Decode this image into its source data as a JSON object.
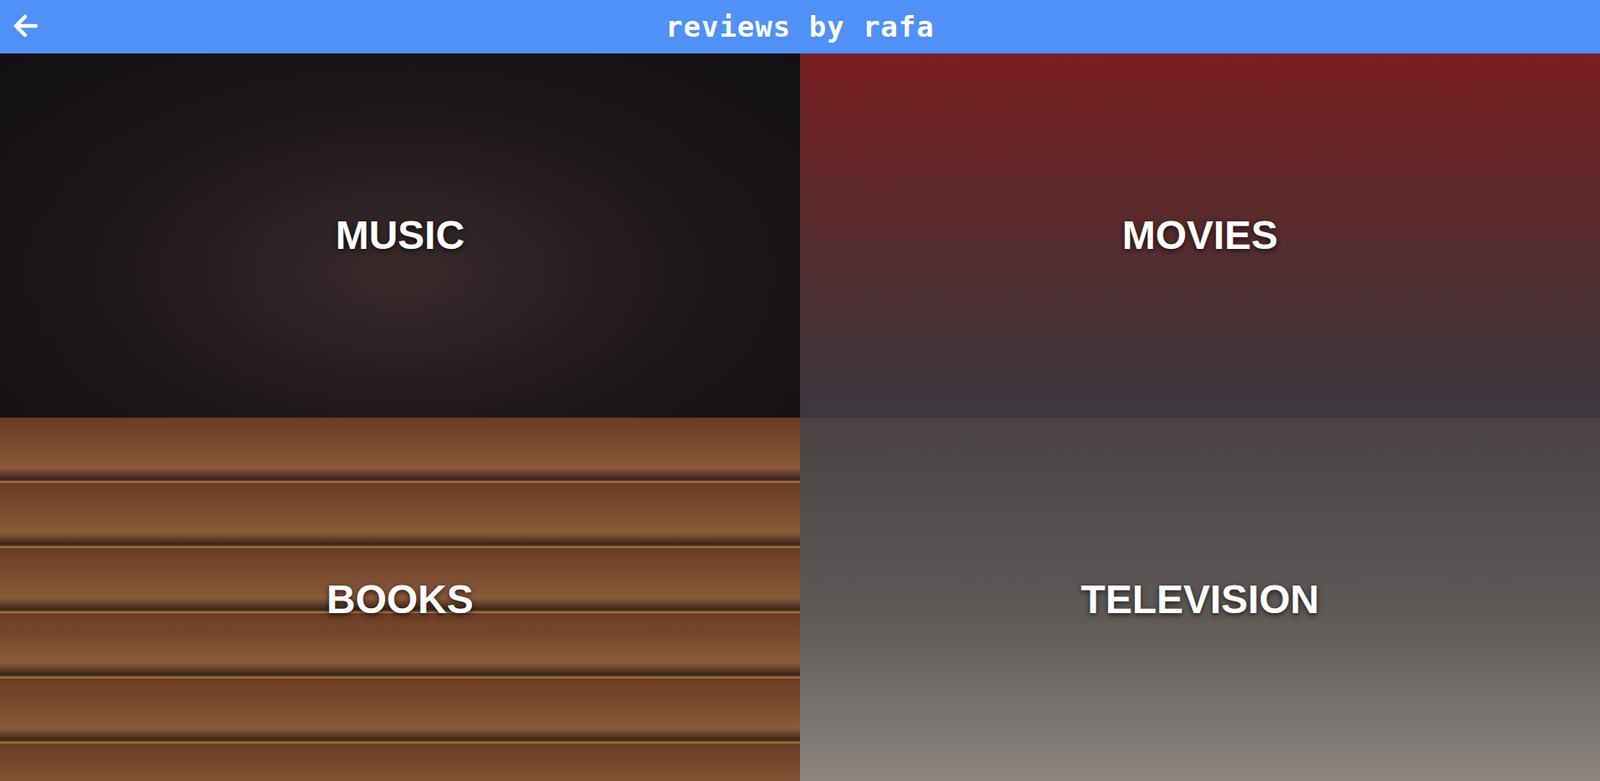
{
  "header": {
    "title": "reviews by rafa"
  },
  "categories": [
    {
      "label": "MUSIC"
    },
    {
      "label": "MOVIES"
    },
    {
      "label": "BOOKS"
    },
    {
      "label": "TELEVISION"
    }
  ]
}
